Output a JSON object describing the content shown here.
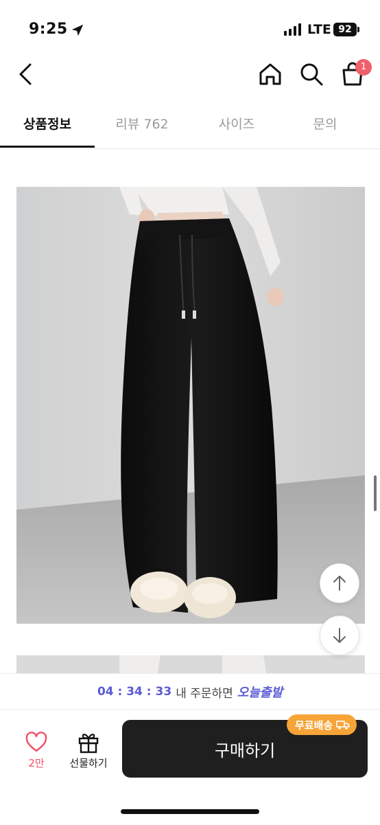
{
  "status_bar": {
    "time": "9:25",
    "network": "LTE",
    "battery": "92"
  },
  "header": {
    "back_icon": "chevron-left-icon",
    "home_icon": "home-icon",
    "search_icon": "search-icon",
    "cart_icon": "shopping-bag-icon",
    "cart_count": "1"
  },
  "tabs": [
    {
      "label": "상품정보",
      "active": true
    },
    {
      "label": "리뷰 762",
      "active": false
    },
    {
      "label": "사이즈",
      "active": false
    },
    {
      "label": "문의",
      "active": false
    }
  ],
  "product_image": {
    "subject": "black wide-leg sweatpants with drawstring, white fluffy slippers"
  },
  "scroll_controls": {
    "up_icon": "arrow-up-icon",
    "down_icon": "arrow-down-icon"
  },
  "order_banner": {
    "countdown": "04 : 34 : 33",
    "text": "내 주문하면",
    "highlight": "오늘출발"
  },
  "bottom_bar": {
    "like_icon": "heart-icon",
    "like_count": "2만",
    "gift_icon": "gift-icon",
    "gift_label": "선물하기",
    "buy_label": "구매하기",
    "free_shipping_label": "무료배송",
    "free_shipping_icon": "truck-icon"
  },
  "colors": {
    "accent": "#5b5bd6",
    "badge": "#f0606a",
    "like": "#ee4d63",
    "free_shipping": "#f6a437",
    "buy_button": "#1f1f1f"
  }
}
